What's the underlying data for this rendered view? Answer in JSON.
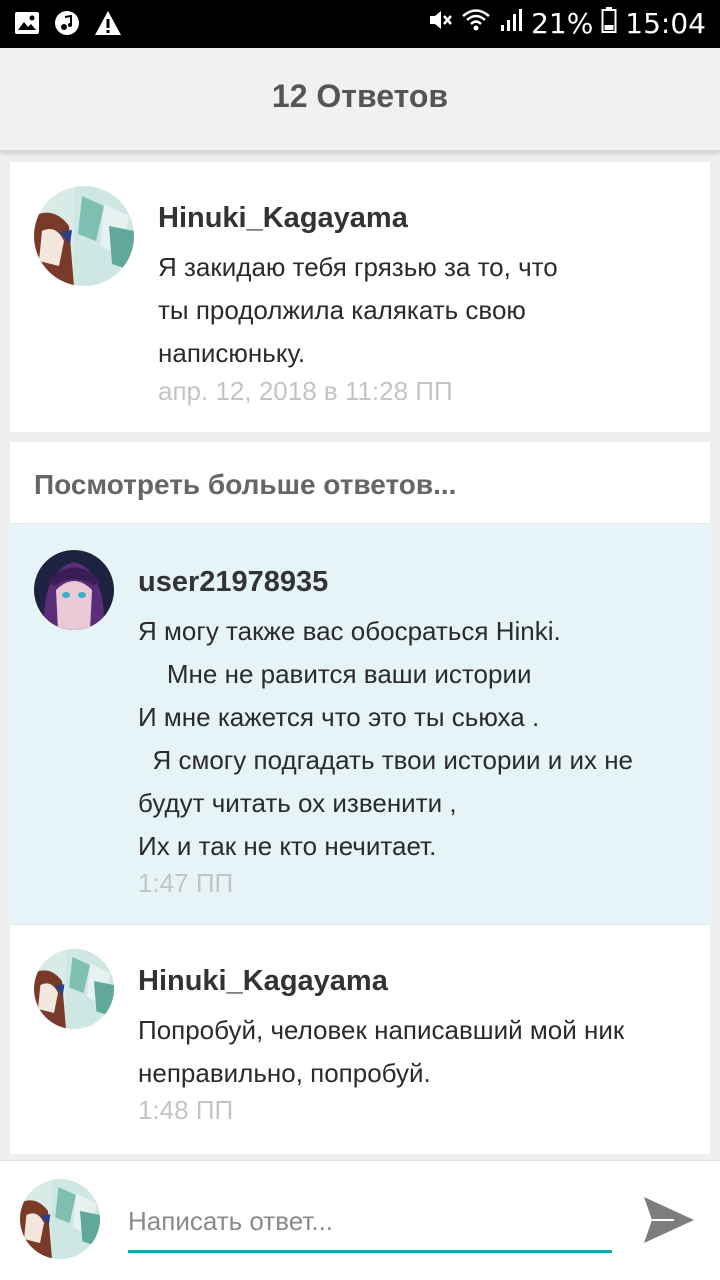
{
  "status_bar": {
    "battery": "21%",
    "time": "15:04",
    "left_icons": [
      "image-icon",
      "music-icon",
      "warning-icon"
    ],
    "right_icons": [
      "mute-icon",
      "wifi-icon",
      "signal-icon",
      "battery-icon"
    ]
  },
  "header": {
    "title": "12 Ответов"
  },
  "parent_comment": {
    "author": "Hinuki_Kagayama",
    "text": "Я закидаю тебя грязью за то, что\nты продолжила калякать свою\nнаписюньку.",
    "time": "апр. 12, 2018 в 11:28 ПП"
  },
  "more_replies_label": "Посмотреть больше ответов...",
  "replies": [
    {
      "author": "user21978935",
      "text": "Я могу также вас обосраться Hinki.\n    Мне не равится ваши истории\nИ мне кажется что это ты сьюха .\n  Я смогу подгадать твои истории и их не\nбудут читать ох извенити ,\nИх и так не кто нечитает.",
      "time": "1:47 ПП"
    },
    {
      "author": "Hinuki_Kagayama",
      "text": "Попробуй, человек написавший мой ник\nнеправильно, попробуй.",
      "time": "1:48 ПП"
    }
  ],
  "composer": {
    "placeholder": "Написать ответ...",
    "value": ""
  },
  "colors": {
    "accent": "#1ba3b8",
    "highlight_bg": "#e6f4f8",
    "timestamp": "#c4c4c4"
  }
}
